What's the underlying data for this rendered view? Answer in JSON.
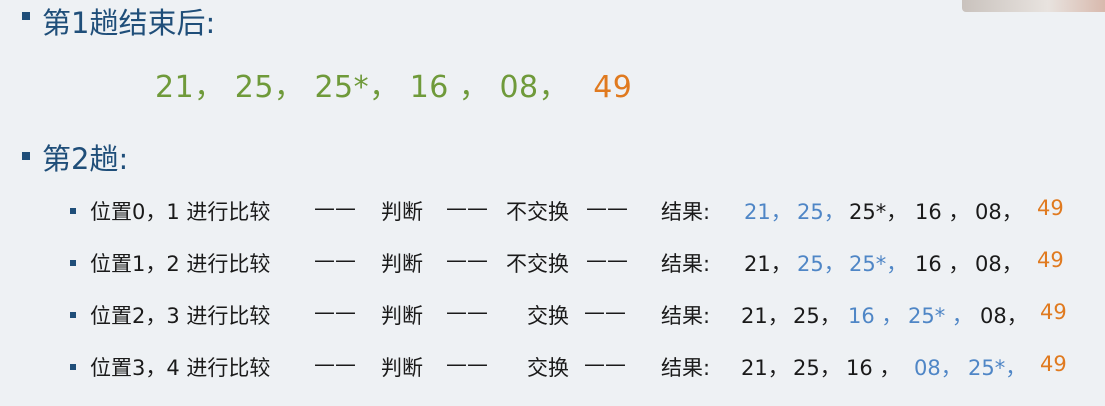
{
  "section1": {
    "title": "第1趟结束后:",
    "sequence": [
      "21，",
      "25，",
      "25*，",
      "16 ，",
      "08，",
      "49"
    ]
  },
  "section2": {
    "title": "第2趟:",
    "rows": [
      {
        "position": "位置0，1 进行比较",
        "dash1": "——",
        "judge": "判断",
        "dash2": "——",
        "action": "不交换",
        "dash3": "——",
        "result_label": "结果:",
        "values": [
          {
            "text": "21，",
            "color": "blue"
          },
          {
            "text": "25，",
            "color": "blue"
          },
          {
            "text": "25*，",
            "color": "black"
          },
          {
            "text": "16 ，",
            "color": "black"
          },
          {
            "text": "08，",
            "color": "black"
          },
          {
            "text": "49",
            "color": "orange"
          }
        ]
      },
      {
        "position": "位置1，2 进行比较",
        "dash1": "——",
        "judge": "判断",
        "dash2": "——",
        "action": "不交换",
        "dash3": "——",
        "result_label": "结果:",
        "values": [
          {
            "text": "21，",
            "color": "black"
          },
          {
            "text": "25，",
            "color": "blue"
          },
          {
            "text": "25*，",
            "color": "blue"
          },
          {
            "text": "16 ，",
            "color": "black"
          },
          {
            "text": "08，",
            "color": "black"
          },
          {
            "text": "49",
            "color": "orange"
          }
        ]
      },
      {
        "position": "位置2，3 进行比较",
        "dash1": "——",
        "judge": "判断",
        "dash2": "——",
        "action": "交换",
        "dash3": "——",
        "result_label": "结果:",
        "values": [
          {
            "text": "21，",
            "color": "black"
          },
          {
            "text": "25，",
            "color": "black"
          },
          {
            "text": "16 ，",
            "color": "blue"
          },
          {
            "text": "25* ，",
            "color": "blue"
          },
          {
            "text": "08，",
            "color": "black"
          },
          {
            "text": "49",
            "color": "orange"
          }
        ]
      },
      {
        "position": "位置3，4 进行比较",
        "dash1": "——",
        "judge": "判断",
        "dash2": "——",
        "action": "交换",
        "dash3": "——",
        "result_label": "结果:",
        "values": [
          {
            "text": "21，",
            "color": "black"
          },
          {
            "text": "25，",
            "color": "black"
          },
          {
            "text": "16 ，",
            "color": "black"
          },
          {
            "text": "08，",
            "color": "blue"
          },
          {
            "text": "25*，",
            "color": "blue"
          },
          {
            "text": "49",
            "color": "orange"
          }
        ]
      }
    ]
  },
  "colors": {
    "heading": "#1f4e79",
    "green": "#6f9a3a",
    "orange": "#e07a1f",
    "blue": "#4f86c6",
    "black": "#1a1a1a"
  }
}
